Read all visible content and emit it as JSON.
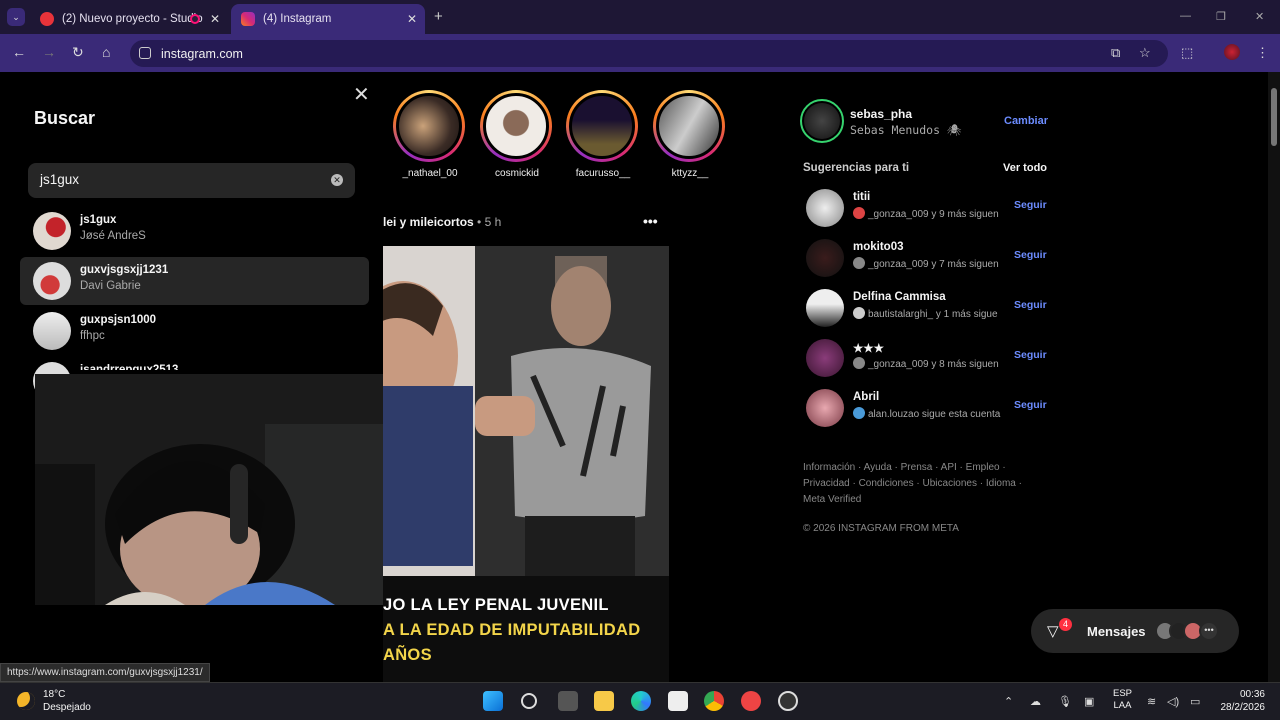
{
  "browser": {
    "tabs": [
      {
        "title": "(2) Nuevo proyecto - Studio",
        "active": false
      },
      {
        "title": "(4) Instagram",
        "active": true
      }
    ],
    "url": "instagram.com",
    "hover_url": "https://www.instagram.com/guxvjsgsxjj1231/"
  },
  "search": {
    "title": "Buscar",
    "query": "js1gux",
    "results": [
      {
        "username": "js1gux",
        "name": "Jøsé AndreS"
      },
      {
        "username": "guxvjsgsxjj1231",
        "name": "Davi Gabrie"
      },
      {
        "username": "guxpsjsn1000",
        "name": "ffhpc"
      },
      {
        "username": "jsandrrepgux2513",
        "name": ""
      }
    ]
  },
  "stories": [
    {
      "username": "_nathael_00"
    },
    {
      "username": "cosmickid"
    },
    {
      "username": "facurusso__"
    },
    {
      "username": "kttyzz__"
    }
  ],
  "post": {
    "author": "lei y mileicortos",
    "time": "5 h",
    "caption_lines": [
      "JO LA LEY PENAL JUVENIL",
      "A LA EDAD DE IMPUTABILIDAD",
      "AÑOS"
    ]
  },
  "profile": {
    "username": "sebas_pha",
    "name": "Sebas Menudos 🕷",
    "switch_label": "Cambiar"
  },
  "suggestions": {
    "title": "Sugerencias para ti",
    "see_all": "Ver todo",
    "follow_label": "Seguir",
    "items": [
      {
        "username": "titii",
        "meta": "_gonzaa_009 y 9 más siguen"
      },
      {
        "username": "mokito03",
        "meta": "_gonzaa_009 y 7 más siguen"
      },
      {
        "username": "Delfina Cammisa",
        "meta": "bautistalarghi_ y 1 más sigue"
      },
      {
        "username": "★★★",
        "meta": "_gonzaa_009 y 8 más siguen"
      },
      {
        "username": "Abril",
        "meta": "alan.louzao sigue esta cuenta"
      }
    ]
  },
  "footer": {
    "links": "Información · Ayuda · Prensa · API · Empleo · Privacidad · Condiciones · Ubicaciones · Idioma · Meta Verified",
    "copyright": "© 2026 INSTAGRAM FROM META"
  },
  "messages": {
    "label": "Mensajes",
    "badge": "4"
  },
  "taskbar": {
    "temp": "18°C",
    "weather": "Despejado",
    "lang_top": "ESP",
    "lang_bottom": "LAA",
    "time": "00:36",
    "date": "28/2/2026"
  },
  "colors": {
    "accent": "#3a2a78",
    "link": "#6c8cff",
    "story_ring": "#d62976"
  }
}
